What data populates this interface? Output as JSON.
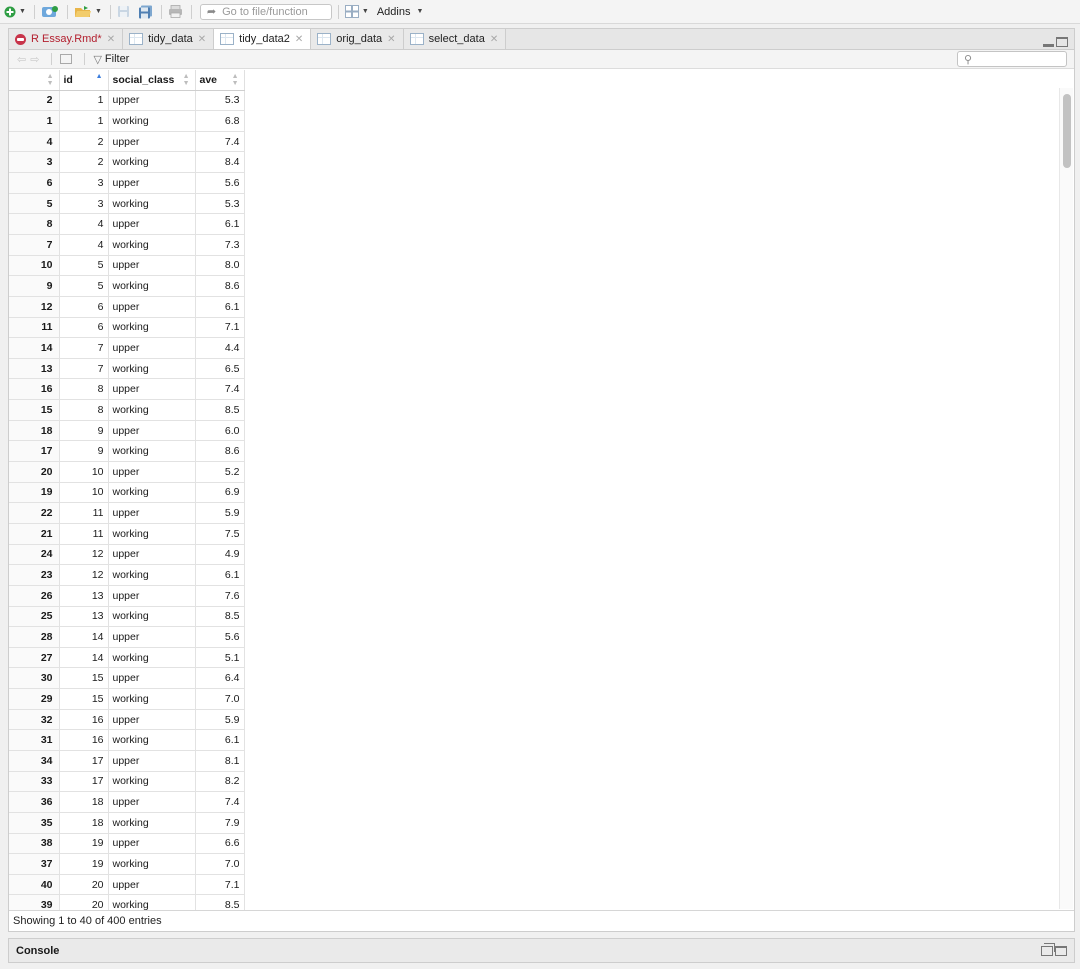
{
  "toolbar": {
    "goto_placeholder": "Go to file/function",
    "addins_label": "Addins"
  },
  "tabs": [
    {
      "label": "R Essay.Rmd*",
      "kind": "rmd",
      "active": false
    },
    {
      "label": "tidy_data",
      "kind": "data",
      "active": false
    },
    {
      "label": "tidy_data2",
      "kind": "data",
      "active": true
    },
    {
      "label": "orig_data",
      "kind": "data",
      "active": false
    },
    {
      "label": "select_data",
      "kind": "data",
      "active": false
    }
  ],
  "viewer": {
    "filter_label": "Filter",
    "columns": [
      "",
      "id",
      "social_class",
      "ave"
    ],
    "sorted_column": "id",
    "rows": [
      [
        "2",
        "1",
        "upper",
        "5.3"
      ],
      [
        "1",
        "1",
        "working",
        "6.8"
      ],
      [
        "4",
        "2",
        "upper",
        "7.4"
      ],
      [
        "3",
        "2",
        "working",
        "8.4"
      ],
      [
        "6",
        "3",
        "upper",
        "5.6"
      ],
      [
        "5",
        "3",
        "working",
        "5.3"
      ],
      [
        "8",
        "4",
        "upper",
        "6.1"
      ],
      [
        "7",
        "4",
        "working",
        "7.3"
      ],
      [
        "10",
        "5",
        "upper",
        "8.0"
      ],
      [
        "9",
        "5",
        "working",
        "8.6"
      ],
      [
        "12",
        "6",
        "upper",
        "6.1"
      ],
      [
        "11",
        "6",
        "working",
        "7.1"
      ],
      [
        "14",
        "7",
        "upper",
        "4.4"
      ],
      [
        "13",
        "7",
        "working",
        "6.5"
      ],
      [
        "16",
        "8",
        "upper",
        "7.4"
      ],
      [
        "15",
        "8",
        "working",
        "8.5"
      ],
      [
        "18",
        "9",
        "upper",
        "6.0"
      ],
      [
        "17",
        "9",
        "working",
        "8.6"
      ],
      [
        "20",
        "10",
        "upper",
        "5.2"
      ],
      [
        "19",
        "10",
        "working",
        "6.9"
      ],
      [
        "22",
        "11",
        "upper",
        "5.9"
      ],
      [
        "21",
        "11",
        "working",
        "7.5"
      ],
      [
        "24",
        "12",
        "upper",
        "4.9"
      ],
      [
        "23",
        "12",
        "working",
        "6.1"
      ],
      [
        "26",
        "13",
        "upper",
        "7.6"
      ],
      [
        "25",
        "13",
        "working",
        "8.5"
      ],
      [
        "28",
        "14",
        "upper",
        "5.6"
      ],
      [
        "27",
        "14",
        "working",
        "5.1"
      ],
      [
        "30",
        "15",
        "upper",
        "6.4"
      ],
      [
        "29",
        "15",
        "working",
        "7.0"
      ],
      [
        "32",
        "16",
        "upper",
        "5.9"
      ],
      [
        "31",
        "16",
        "working",
        "6.1"
      ],
      [
        "34",
        "17",
        "upper",
        "8.1"
      ],
      [
        "33",
        "17",
        "working",
        "8.2"
      ],
      [
        "36",
        "18",
        "upper",
        "7.4"
      ],
      [
        "35",
        "18",
        "working",
        "7.9"
      ],
      [
        "38",
        "19",
        "upper",
        "6.6"
      ],
      [
        "37",
        "19",
        "working",
        "7.0"
      ],
      [
        "40",
        "20",
        "upper",
        "7.1"
      ],
      [
        "39",
        "20",
        "working",
        "8.5"
      ]
    ],
    "status": "Showing 1 to 40 of 400 entries"
  },
  "console": {
    "title": "Console"
  },
  "colors": {
    "rmd_tab_text": "#b3202f",
    "sort_active": "#3b7ddd"
  }
}
